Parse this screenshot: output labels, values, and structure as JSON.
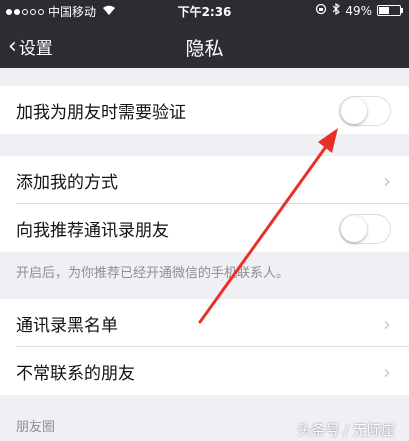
{
  "status_bar": {
    "carrier": "中国移动",
    "time": "下午2:36",
    "battery_percent": "49%",
    "battery_level": 0.49,
    "icons": [
      "signal-dots-icon",
      "wifi-icon",
      "rotation-lock-icon",
      "bluetooth-icon",
      "battery-icon"
    ]
  },
  "nav": {
    "back_label": "设置",
    "title": "隐私"
  },
  "rows": {
    "verify": {
      "label": "加我为朋友时需要验证",
      "toggle_on": false
    },
    "add_methods": {
      "label": "添加我的方式"
    },
    "recommend_contacts": {
      "label": "向我推荐通讯录朋友",
      "toggle_on": false
    },
    "blacklist": {
      "label": "通讯录黑名单"
    },
    "infrequent": {
      "label": "不常联系的朋友"
    }
  },
  "hint": "开启后，为你推荐已经开通微信的手机联系人。",
  "section_moments": "朋友圈",
  "watermark": "头条号 / 无际崖",
  "colors": {
    "nav_bg": "#2e2e32",
    "background": "#efeff4",
    "arrow": "#e8302a"
  }
}
